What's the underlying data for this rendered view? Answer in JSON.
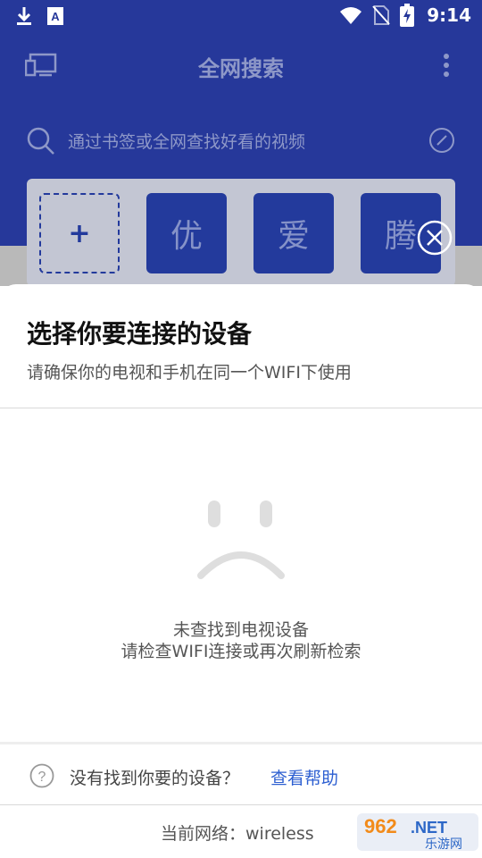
{
  "status_bar": {
    "time": "9:14"
  },
  "app": {
    "title": "全网搜索",
    "search_placeholder": "通过书签或全网查找好看的视频",
    "sites": [
      {
        "label": "+"
      },
      {
        "label": "优"
      },
      {
        "label": "爱"
      },
      {
        "label": "腾"
      }
    ]
  },
  "dialog": {
    "title": "选择你要连接的设备",
    "subtitle": "请确保你的电视和手机在同一个WIFI下使用",
    "empty_line1": "未查找到电视设备",
    "empty_line2": "请检查WIFI连接或再次刷新检索",
    "help_question": "没有找到你要的设备？",
    "help_link": "查看帮助",
    "network_label": "当前网络：wireless"
  },
  "watermark": {
    "brand": "962.NET",
    "sub": "乐游网"
  },
  "colors": {
    "app_blue": "#26389a",
    "link_blue": "#2d5fd1"
  },
  "icons": [
    "download-icon",
    "font-a-icon",
    "wifi-icon",
    "no-sim-icon",
    "battery-charging-icon",
    "tv-icon",
    "more-icon",
    "search-icon",
    "edit-icon",
    "close-circle-icon",
    "sad-face-icon",
    "help-icon"
  ]
}
